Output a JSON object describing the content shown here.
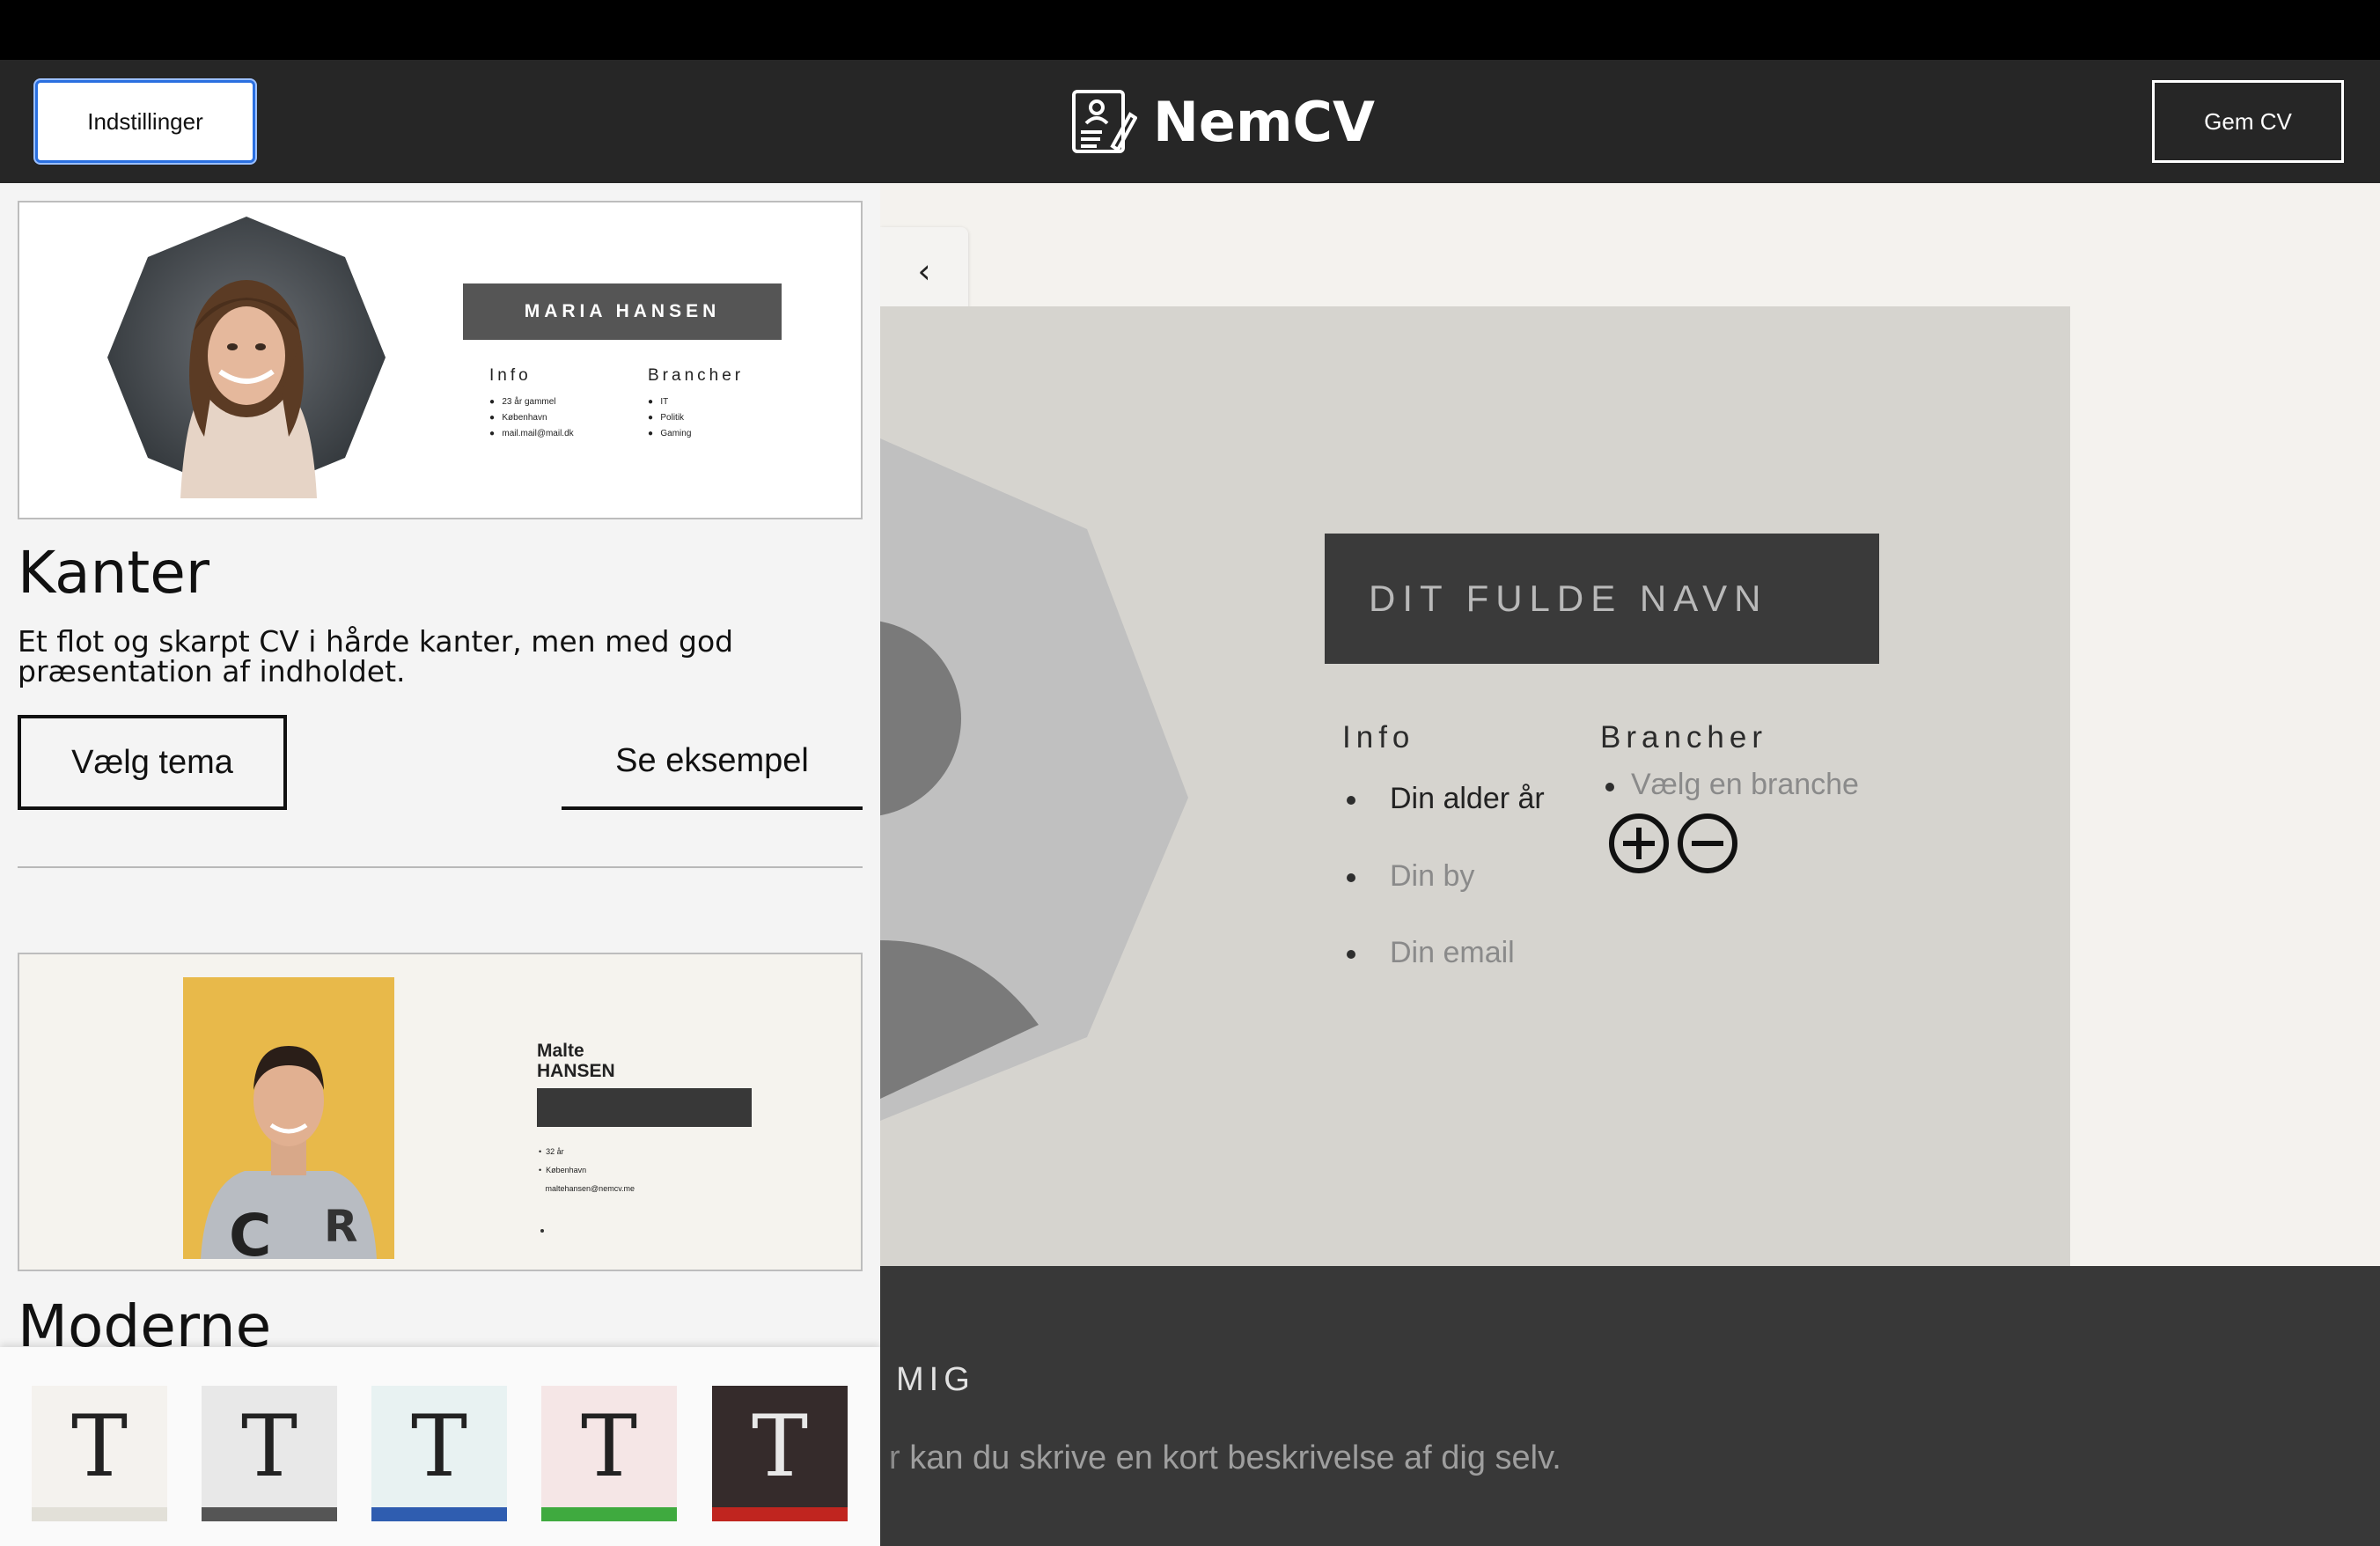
{
  "header": {
    "settings_label": "Indstillinger",
    "app_title": "NemCV",
    "save_label": "Gem CV"
  },
  "sidebar": {
    "themes": [
      {
        "name": "Kanter",
        "description": "Et flot og skarpt CV i hårde kanter, men med god præsentation af indholdet.",
        "choose_label": "Vælg tema",
        "example_label": "Se eksempel",
        "preview": {
          "name": "MARIA HANSEN",
          "info_title": "Info",
          "info_items": [
            "23 år gammel",
            "København",
            "mail.mail@mail.dk"
          ],
          "branches_title": "Brancher",
          "branches_items": [
            "IT",
            "Politik",
            "Gaming"
          ]
        }
      },
      {
        "name": "Moderne",
        "preview": {
          "first_name": "Malte",
          "last_name": "HANSEN",
          "items": [
            "32 år",
            "København",
            "maltehansen@nemcv.me"
          ]
        }
      }
    ],
    "color_swatches": [
      {
        "letter": "T",
        "background": "#f4f2ee",
        "stripe": "#e2e0d8",
        "text": "#222222"
      },
      {
        "letter": "T",
        "background": "#e8e8e8",
        "stripe": "#555555",
        "text": "#222222"
      },
      {
        "letter": "T",
        "background": "#e8f2f2",
        "stripe": "#2f5db0",
        "text": "#222222"
      },
      {
        "letter": "T",
        "background": "#f5e6e6",
        "stripe": "#3faa3f",
        "text": "#222222"
      },
      {
        "letter": "T",
        "background": "#352b2b",
        "stripe": "#c0251f",
        "text": "#e8e8e8"
      }
    ]
  },
  "cv": {
    "name_placeholder": "DIT FULDE NAVN",
    "info_title": "Info",
    "info_items": [
      "Din alder år",
      "Din by",
      "Din email"
    ],
    "branches_title": "Brancher",
    "branch_placeholder": "Vælg en branche",
    "about_title": "MIG",
    "about_text": "kan du skrive en kort beskrivelse af dig selv."
  }
}
